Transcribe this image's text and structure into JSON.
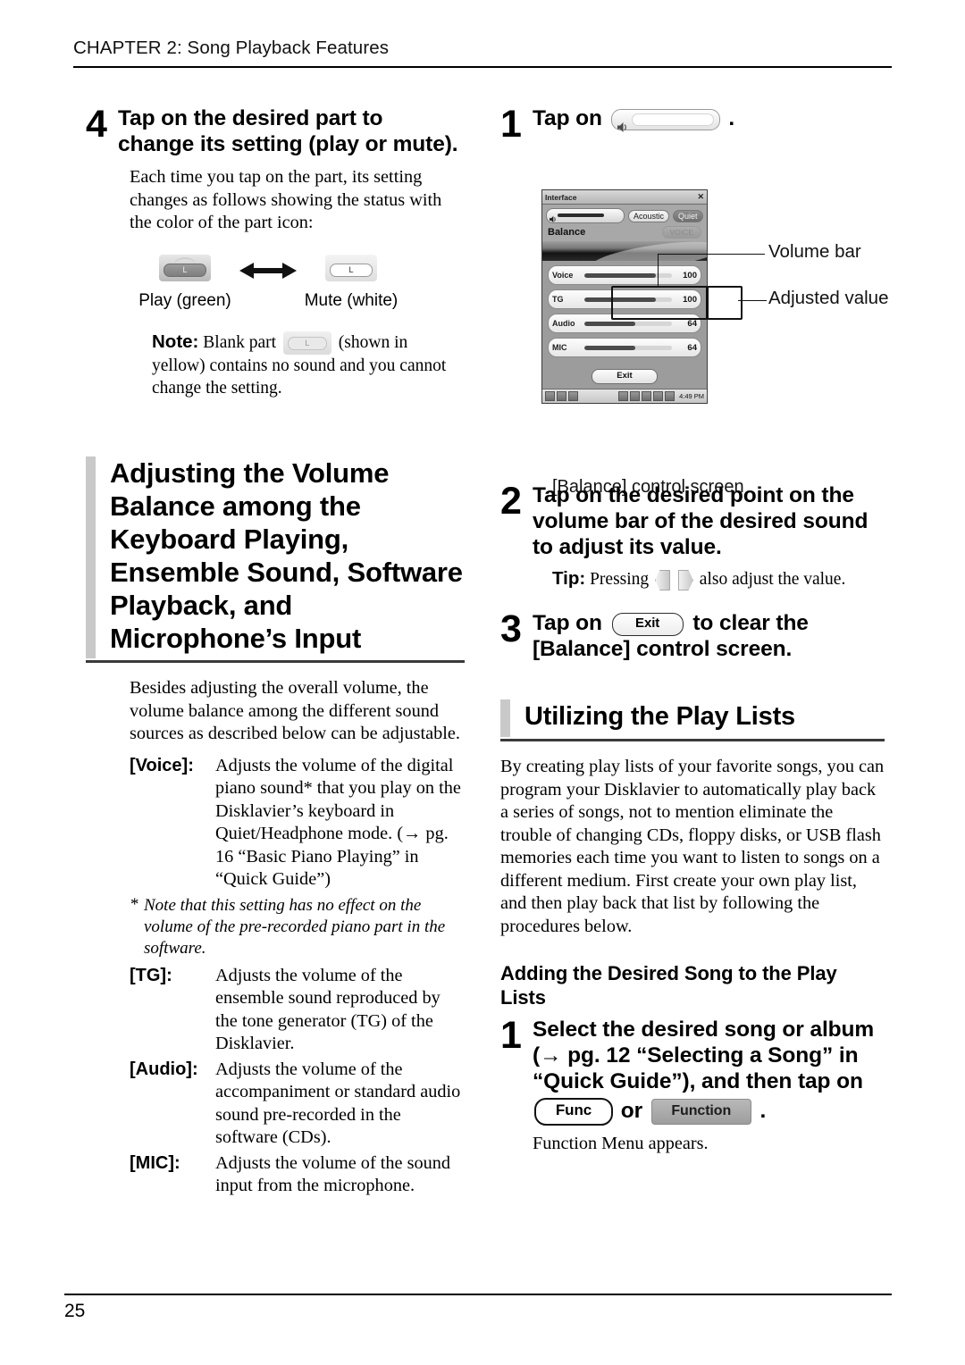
{
  "header": {
    "chapter": "CHAPTER 2: Song Playback Features"
  },
  "footer": {
    "page_number": "25"
  },
  "left_column": {
    "step4": {
      "number": "4",
      "title": "Tap on the desired part to change its setting (play or mute).",
      "body": "Each time you tap on the part, its setting changes as follows showing the status with the color of the part icon:",
      "icons": {
        "play_label": "Play (green)",
        "mute_label": "Mute (white)",
        "pill_letter": "L"
      },
      "note": {
        "label": "Note:",
        "text_before": "Blank part",
        "blank_pill_letter": "L",
        "text_after": "(shown in yellow) contains no sound and you cannot change the setting."
      }
    },
    "section": {
      "title": "Adjusting the Volume Balance among the Keyboard Playing, Ensemble Sound, Software Playback, and Microphone’s Input",
      "intro": "Besides adjusting the overall volume, the volume balance among the different sound sources as described below can be adjustable.",
      "definitions": [
        {
          "term": "[Voice]:",
          "desc": "Adjusts the volume of the digital piano sound* that you play on the Disklavier’s keyboard in Quiet/Headphone mode. (→ pg. 16 “Basic Piano Playing” in “Quick Guide”)"
        },
        {
          "term": "[TG]:",
          "desc": "Adjusts the volume of the ensemble sound reproduced by the tone generator (TG) of the Disklavier."
        },
        {
          "term": "[Audio]:",
          "desc": "Adjusts the volume of the accompaniment or standard audio sound pre-recorded in the software (CDs)."
        },
        {
          "term": "[MIC]:",
          "desc": "Adjusts the volume of the sound input from the microphone."
        }
      ],
      "footnote": {
        "mark": "*",
        "text": "Note that this setting has no effect on the volume of the pre-recorded piano part in the software."
      }
    }
  },
  "right_column": {
    "step1": {
      "number": "1",
      "title_before": "Tap on",
      "title_after": ".",
      "volume_bar_icon": "volume-bar-icon"
    },
    "device": {
      "window_title": "Interface",
      "close_icon": "close-icon",
      "mode_buttons": [
        {
          "label": "Acoustic",
          "active": false
        },
        {
          "label": "Quiet",
          "active": true
        }
      ],
      "balance_label": "Balance",
      "voice_ghost_button": "VOICE",
      "sliders": [
        {
          "name": "Voice",
          "value": "100",
          "fill_percent": 82
        },
        {
          "name": "TG",
          "value": "100",
          "fill_percent": 82
        },
        {
          "name": "Audio",
          "value": "64",
          "fill_percent": 58
        },
        {
          "name": "MIC",
          "value": "64",
          "fill_percent": 58
        }
      ],
      "exit_label": "Exit",
      "taskbar_time": "4:49 PM",
      "callouts": {
        "volume_bar": "Volume bar",
        "adjusted_value": "Adjusted value"
      },
      "caption": "[Balance] control screen"
    },
    "step2": {
      "number": "2",
      "title": "Tap on the desired point on the volume bar of the desired sound to adjust its value.",
      "tip": {
        "label": "Tip:",
        "text_before": "Pressing",
        "text_after": "also adjust the value.",
        "left_icon": "arrow-left-button-icon",
        "right_icon": "arrow-right-button-icon"
      }
    },
    "step3": {
      "number": "3",
      "title_before": "Tap on",
      "exit_button_label": "Exit",
      "title_after": "to clear the [Balance] control screen."
    },
    "playlists_section": {
      "title": "Utilizing the Play Lists",
      "intro": "By creating play lists of your favorite songs, you can program your Disklavier to automatically play back a series of songs, not to mention eliminate the trouble of changing CDs, floppy disks, or USB flash memories each time you want to listen to songs on a different medium. First create your own play list, and then play back that list by following the procedures below.",
      "sub_head": "Adding the Desired Song to the Play Lists",
      "step1": {
        "number": "1",
        "title_line1": "Select the desired song or album",
        "title_line2": "(→ pg. 12 “Selecting a Song” in",
        "title_line3": "“Quick Guide”), and then tap on",
        "func_button_label": "Func",
        "or_label": "or",
        "function_button_label": "Function",
        "period": ".",
        "after": "Function Menu appears."
      }
    }
  },
  "colors": {
    "section_bar": "#c9c9c9",
    "rule": "#000000",
    "device_bg": "#8f8f8f"
  }
}
